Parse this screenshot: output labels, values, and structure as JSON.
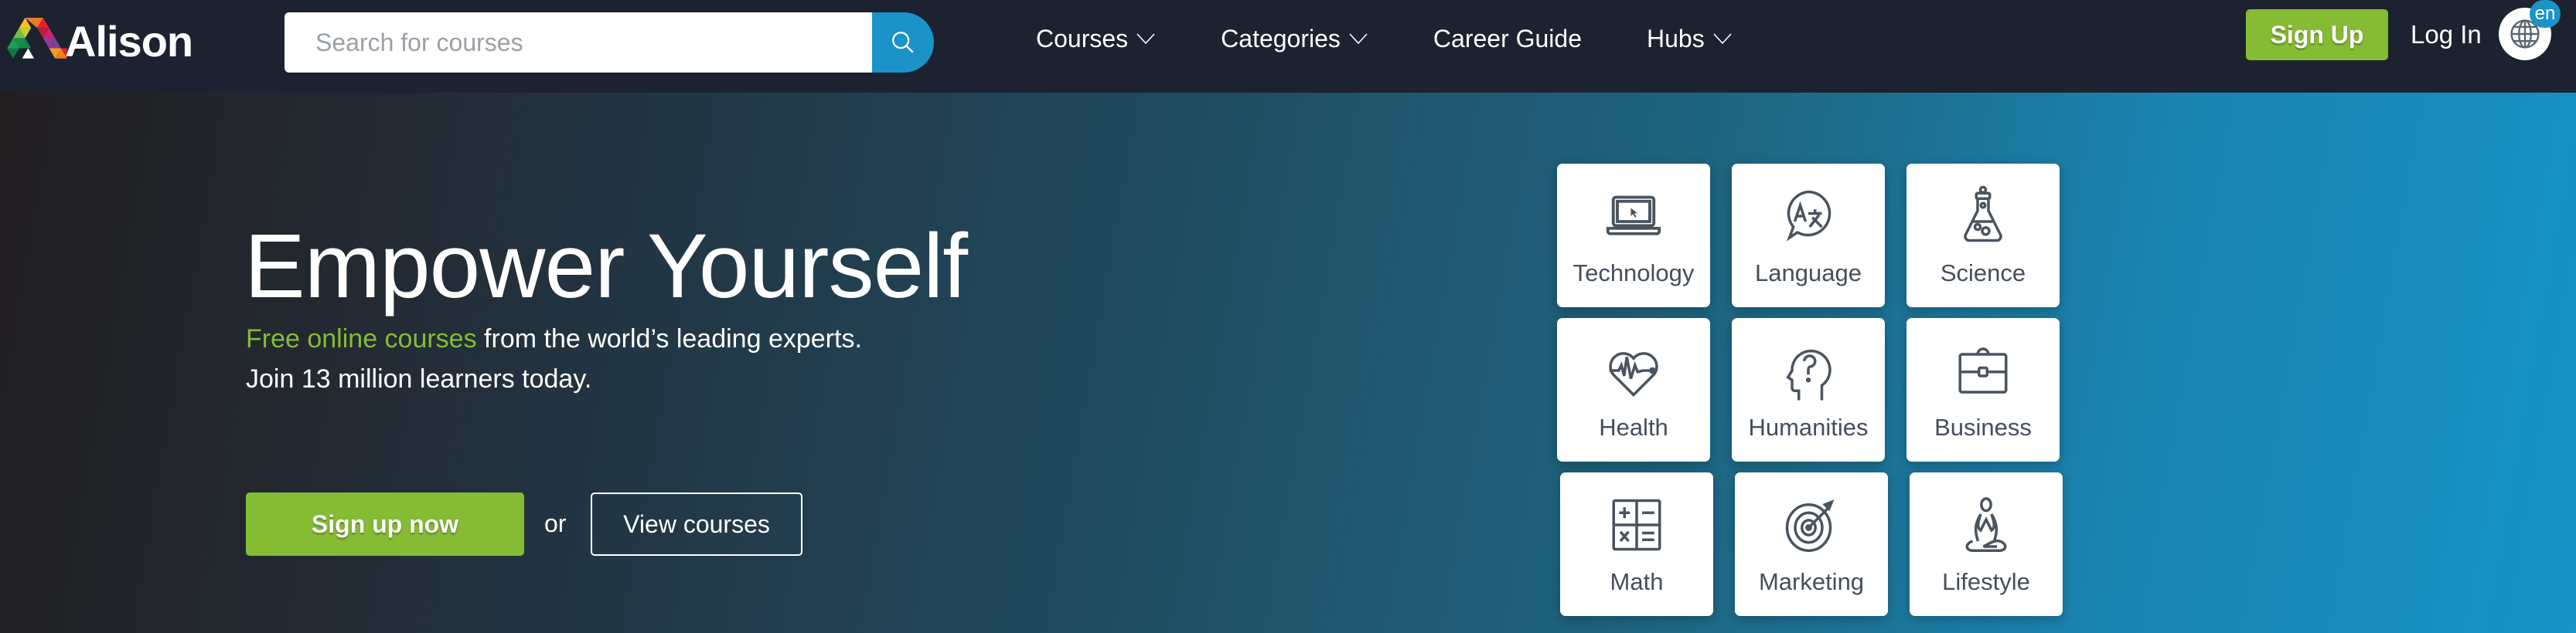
{
  "header": {
    "brand": "Alison",
    "search": {
      "placeholder": "Search for courses",
      "value": ""
    },
    "nav": [
      {
        "label": "Courses",
        "has_dropdown": true
      },
      {
        "label": "Categories",
        "has_dropdown": true
      },
      {
        "label": "Career Guide",
        "has_dropdown": false
      },
      {
        "label": "Hubs",
        "has_dropdown": true
      }
    ],
    "signup_label": "Sign Up",
    "login_label": "Log In",
    "language_badge": "en"
  },
  "hero": {
    "title": "Empower Yourself",
    "line1_accent": "Free online courses",
    "line1_rest": " from the world’s leading experts.",
    "line2": "Join 13 million learners today.",
    "primary_cta": "Sign up now",
    "or_text": "or",
    "secondary_cta": "View courses"
  },
  "categories": [
    {
      "label": "Technology",
      "icon": "laptop-icon"
    },
    {
      "label": "Language",
      "icon": "translate-bubble-icon"
    },
    {
      "label": "Science",
      "icon": "flask-icon"
    },
    {
      "label": "Health",
      "icon": "heart-pulse-icon"
    },
    {
      "label": "Humanities",
      "icon": "head-question-icon"
    },
    {
      "label": "Business",
      "icon": "briefcase-icon"
    },
    {
      "label": "Math",
      "icon": "math-operators-icon"
    },
    {
      "label": "Marketing",
      "icon": "target-icon"
    },
    {
      "label": "Lifestyle",
      "icon": "meditation-icon"
    }
  ],
  "colors": {
    "header_bg": "#1c2230",
    "accent_green": "#85bc33",
    "accent_blue": "#1b93c9",
    "card_text": "#454f5b"
  }
}
